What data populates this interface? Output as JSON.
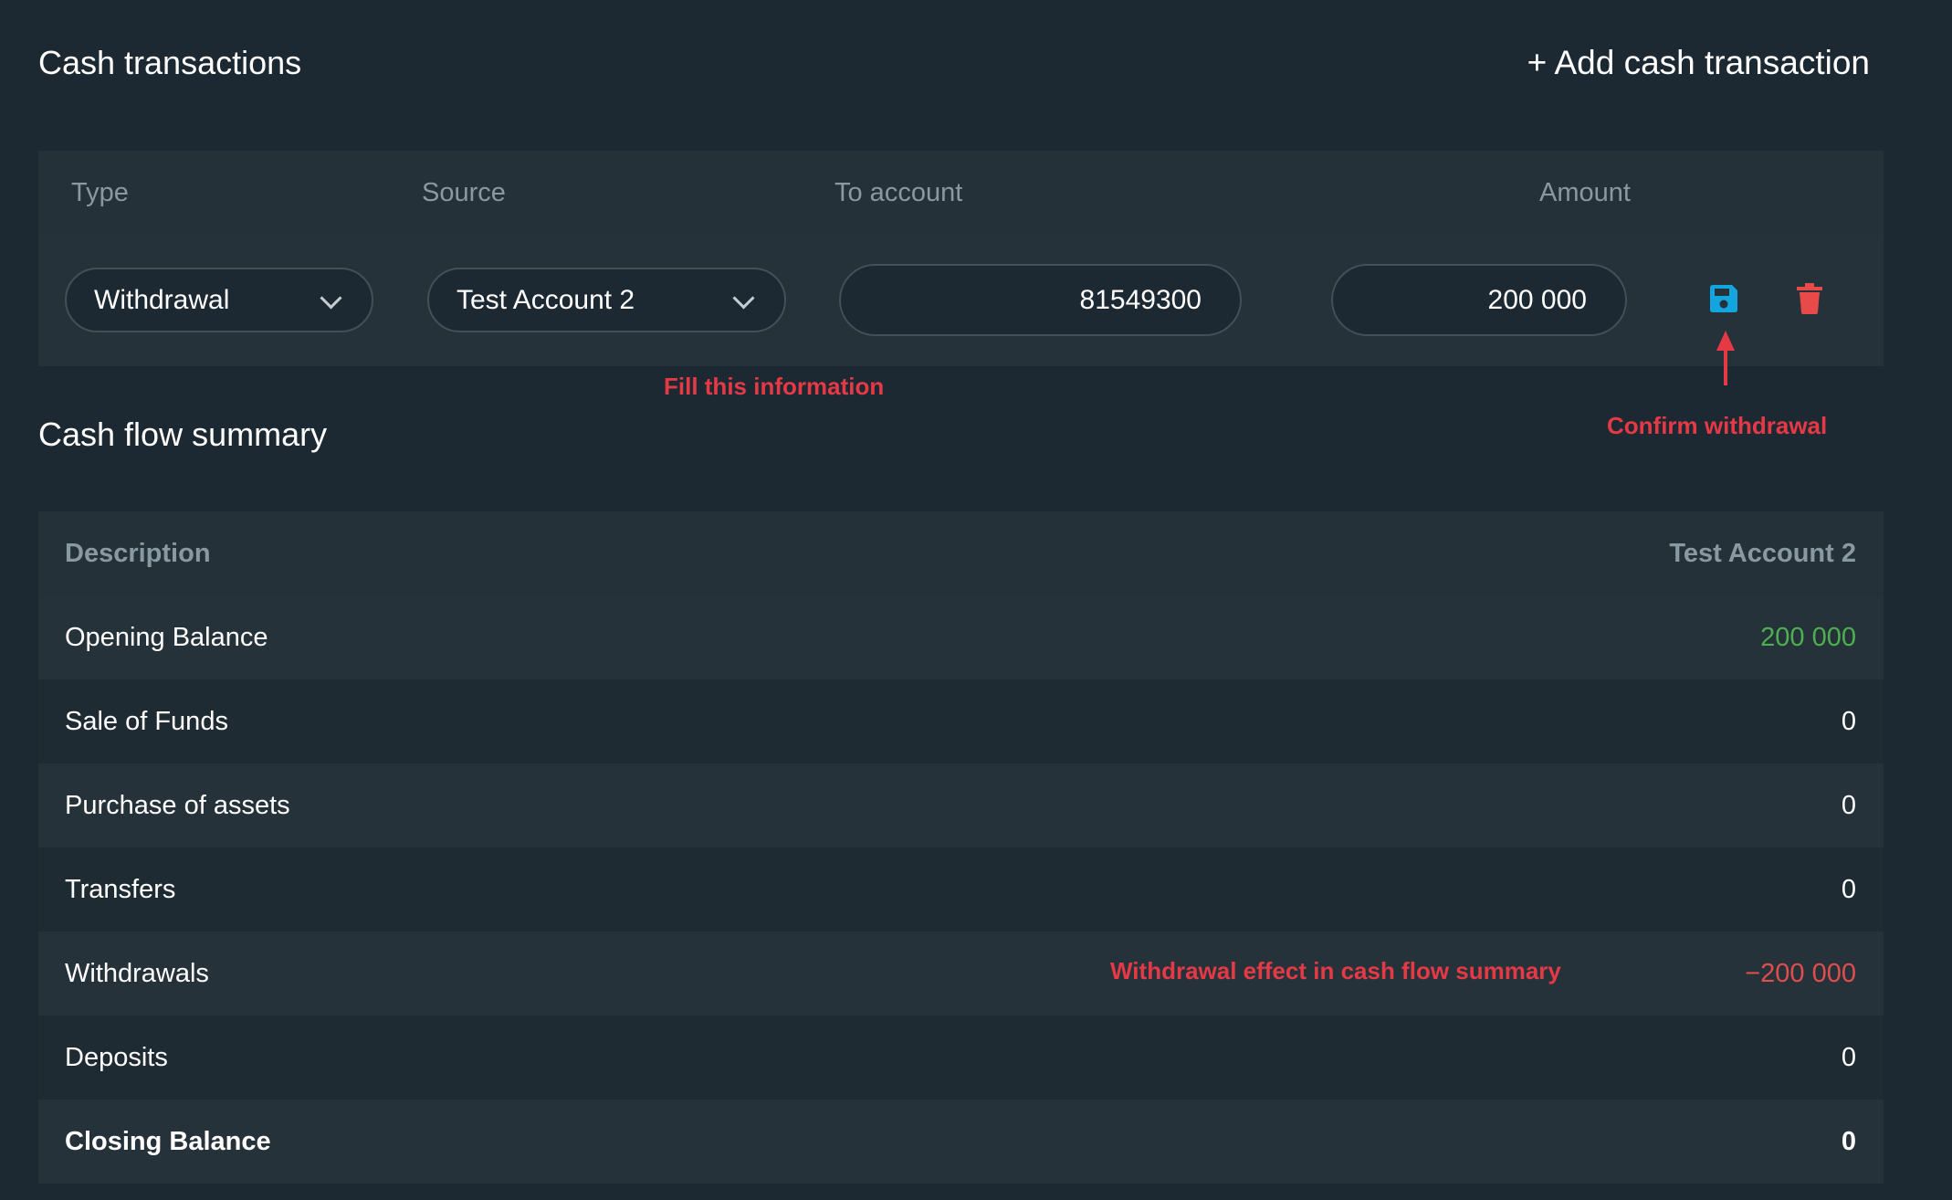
{
  "cash_transactions": {
    "title": "Cash transactions",
    "add_label": "+ Add cash transaction",
    "columns": {
      "type": "Type",
      "source": "Source",
      "to_account": "To account",
      "amount": "Amount"
    },
    "row": {
      "type_value": "Withdrawal",
      "source_value": "Test Account 2",
      "to_account_value": "81549300",
      "amount_value": "200 000"
    }
  },
  "annotations": {
    "fill": "Fill this information",
    "confirm": "Confirm withdrawal",
    "effect": "Withdrawal effect in cash flow summary"
  },
  "cash_flow_summary": {
    "title": "Cash flow summary",
    "header_description": "Description",
    "header_account": "Test Account 2",
    "rows": [
      {
        "label": "Opening Balance",
        "value": "200 000"
      },
      {
        "label": "Sale of Funds",
        "value": "0"
      },
      {
        "label": "Purchase of assets",
        "value": "0"
      },
      {
        "label": "Transfers",
        "value": "0"
      },
      {
        "label": "Withdrawals",
        "value": "−200 000"
      },
      {
        "label": "Deposits",
        "value": "0"
      },
      {
        "label": "Closing Balance",
        "value": "0"
      }
    ]
  },
  "colors": {
    "background": "#1d2932",
    "save_icon": "#12a5e0",
    "delete_icon": "#e84a4a",
    "annotation": "#e63946",
    "positive": "#4caf50",
    "negative": "#e04d4d"
  },
  "icons": {
    "save": "floppy-disk-icon",
    "delete": "trash-icon",
    "dropdown": "chevron-down-icon"
  }
}
